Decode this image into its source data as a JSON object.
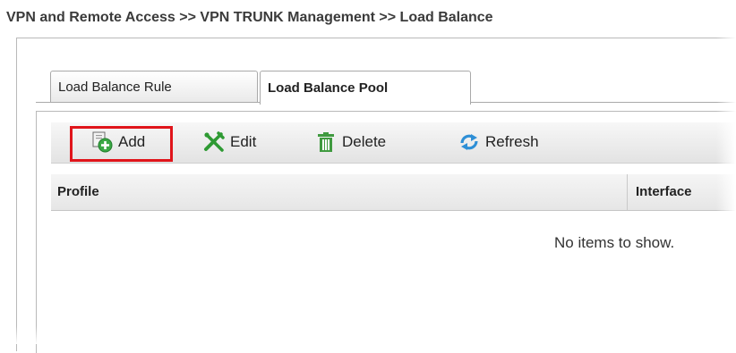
{
  "breadcrumb": "VPN and Remote Access >> VPN TRUNK Management >> Load Balance",
  "tabs": [
    {
      "label": "Load Balance Rule",
      "active": false
    },
    {
      "label": "Load Balance Pool",
      "active": true
    }
  ],
  "toolbar": {
    "add_label": "Add",
    "edit_label": "Edit",
    "delete_label": "Delete",
    "refresh_label": "Refresh"
  },
  "table": {
    "columns": [
      "Profile",
      "Interface"
    ],
    "rows": [],
    "empty_text": "No items to show."
  },
  "colors": {
    "highlight_border": "#e0151b",
    "add_icon": "#3aa845",
    "edit_icon": "#2e9a33",
    "delete_icon": "#3f9a3f",
    "refresh_icon": "#2e8fd6"
  },
  "icons": {
    "add": "add-icon",
    "edit": "edit-icon",
    "delete": "trash-icon",
    "refresh": "refresh-icon"
  }
}
